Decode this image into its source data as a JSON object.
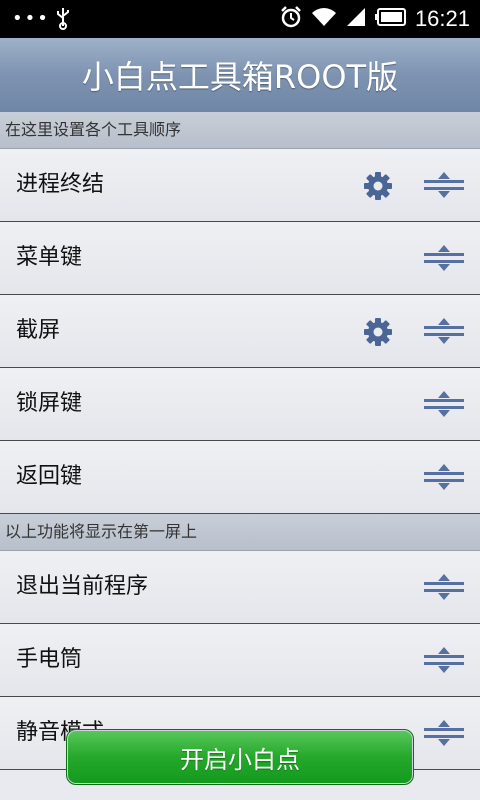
{
  "status_bar": {
    "time": "16:21",
    "overflow_dots": "•••",
    "icons": [
      "usb-icon",
      "alarm-icon",
      "wifi-icon",
      "signal-icon",
      "battery-icon"
    ]
  },
  "app": {
    "title": "小白点工具箱ROOT版"
  },
  "sections": [
    {
      "header": "在这里设置各个工具顺序",
      "items": [
        {
          "label": "进程终结",
          "has_settings": true
        },
        {
          "label": "菜单键",
          "has_settings": false
        },
        {
          "label": "截屏",
          "has_settings": true
        },
        {
          "label": "锁屏键",
          "has_settings": false
        },
        {
          "label": "返回键",
          "has_settings": false
        }
      ]
    },
    {
      "header": "以上功能将显示在第一屏上",
      "items": [
        {
          "label": "退出当前程序",
          "has_settings": false
        },
        {
          "label": "手电筒",
          "has_settings": false
        },
        {
          "label": "静音模式",
          "has_settings": false
        }
      ]
    }
  ],
  "start_button": {
    "label": "开启小白点"
  },
  "colors": {
    "title_bar": "#7d93b1",
    "icon_blue": "#4a6596",
    "button_green": "#25a82b"
  }
}
